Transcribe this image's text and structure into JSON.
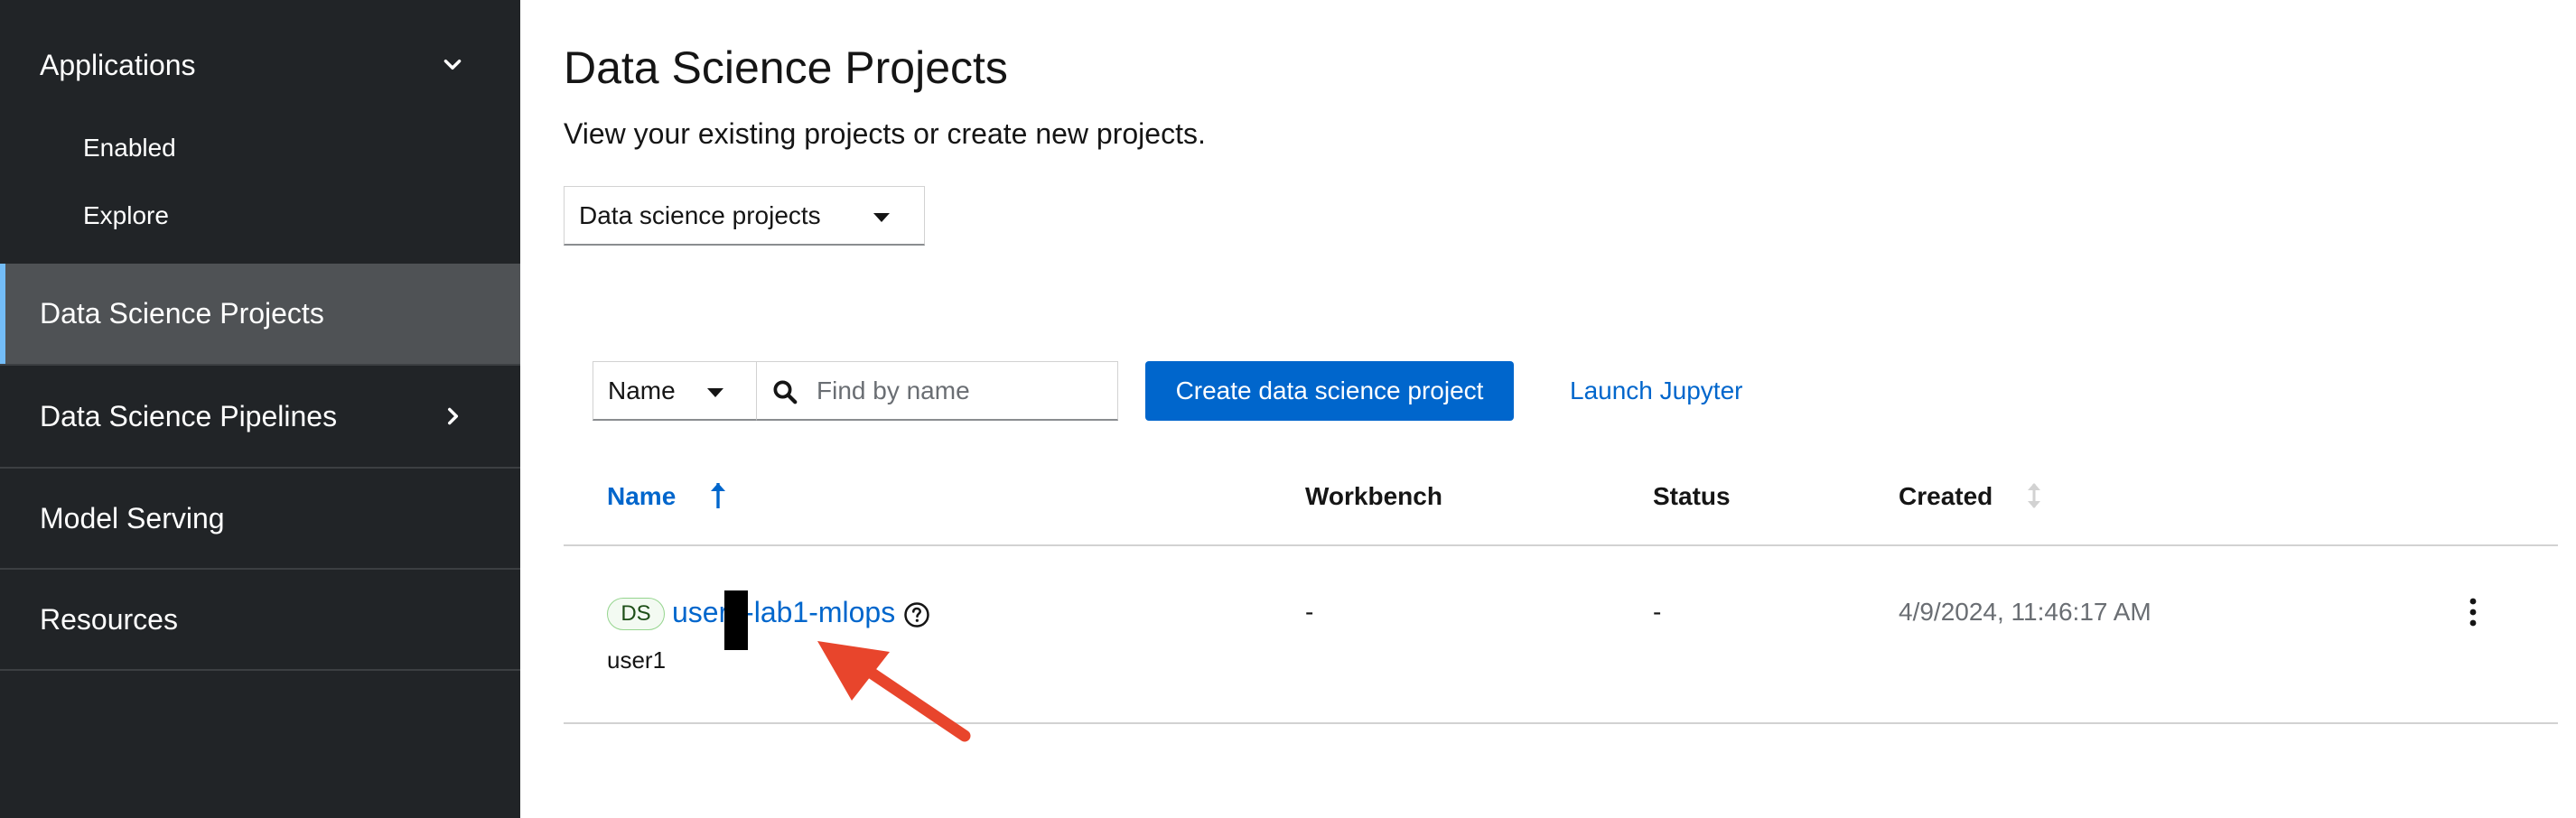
{
  "sidebar": {
    "applications_label": "Applications",
    "applications_sub": [
      "Enabled",
      "Explore"
    ],
    "items": [
      {
        "label": "Data Science Projects"
      },
      {
        "label": "Data Science Pipelines"
      },
      {
        "label": "Model Serving"
      },
      {
        "label": "Resources"
      }
    ],
    "active_item": "Data Science Projects",
    "colors": {
      "background": "#212427",
      "active_background": "#4f5255",
      "active_accent": "#73bcf7"
    }
  },
  "page": {
    "title": "Data Science Projects",
    "subtitle": "View your existing projects or create new projects."
  },
  "project_type_select": {
    "value": "Data science projects"
  },
  "toolbar": {
    "filter_attribute": "Name",
    "search_placeholder": "Find by name",
    "create_button": "Create data science project",
    "launch_link": "Launch Jupyter"
  },
  "table": {
    "columns": [
      "Name",
      "Workbench",
      "Status",
      "Created"
    ],
    "sorted_column": "Name",
    "rows": [
      {
        "badge": "DS",
        "name": "user1-lab1-mlops",
        "owner": "user1",
        "workbench": "-",
        "status": "-",
        "created": "4/9/2024, 11:46:17 AM"
      }
    ]
  },
  "annotation": {
    "type": "arrow",
    "color": "#e8452c"
  },
  "colors": {
    "primary": "#0066cc",
    "text": "#151515",
    "muted": "#6a6e73"
  }
}
